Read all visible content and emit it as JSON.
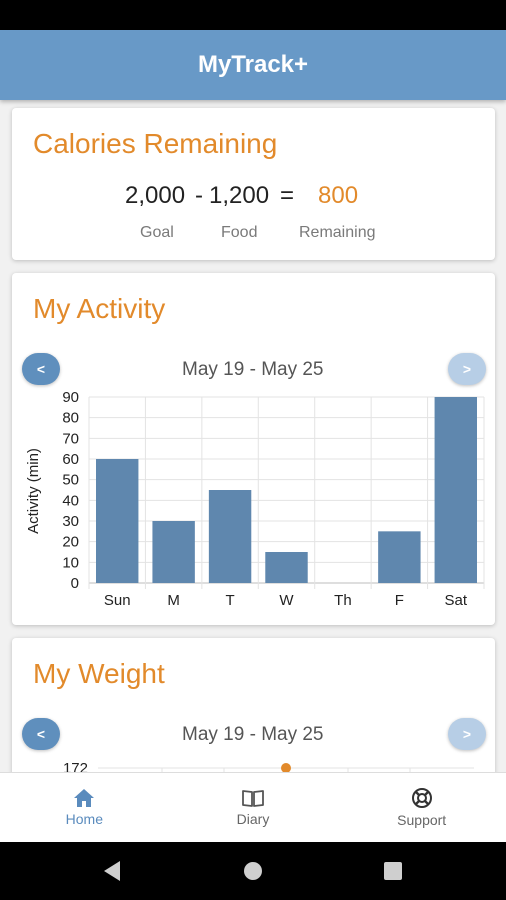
{
  "app": {
    "title": "MyTrack+"
  },
  "calories": {
    "title": "Calories Remaining",
    "goal_value": "2,000",
    "minus": "-",
    "food_value": "1,200",
    "equals": "=",
    "remaining_value": "800",
    "goal_label": "Goal",
    "food_label": "Food",
    "remaining_label": "Remaining"
  },
  "activity": {
    "title": "My Activity",
    "prev_label": "<",
    "next_label": ">",
    "week_label": "May 19 - May 25"
  },
  "weight": {
    "title": "My Weight",
    "prev_label": "<",
    "next_label": ">",
    "week_label": "May 19 - May 25",
    "y_top_tick": "172"
  },
  "bottom_nav": {
    "items": [
      {
        "label": "Home",
        "icon": "home-icon",
        "active": true
      },
      {
        "label": "Diary",
        "icon": "book-icon",
        "active": false
      },
      {
        "label": "Support",
        "icon": "lifebuoy-icon",
        "active": false
      }
    ]
  },
  "colors": {
    "header": "#6899c7",
    "accent": "#e28a2b",
    "bar": "#5f87ae",
    "active_nav": "#5a8bbd"
  },
  "chart_data": {
    "type": "bar",
    "categories": [
      "Sun",
      "M",
      "T",
      "W",
      "Th",
      "F",
      "Sat"
    ],
    "values": [
      60,
      30,
      45,
      15,
      0,
      25,
      90
    ],
    "ylabel": "Activity (min)",
    "xlabel": "",
    "ylim": [
      0,
      90
    ],
    "yticks": [
      0,
      10,
      20,
      30,
      40,
      50,
      60,
      70,
      80,
      90
    ],
    "grid": true
  }
}
